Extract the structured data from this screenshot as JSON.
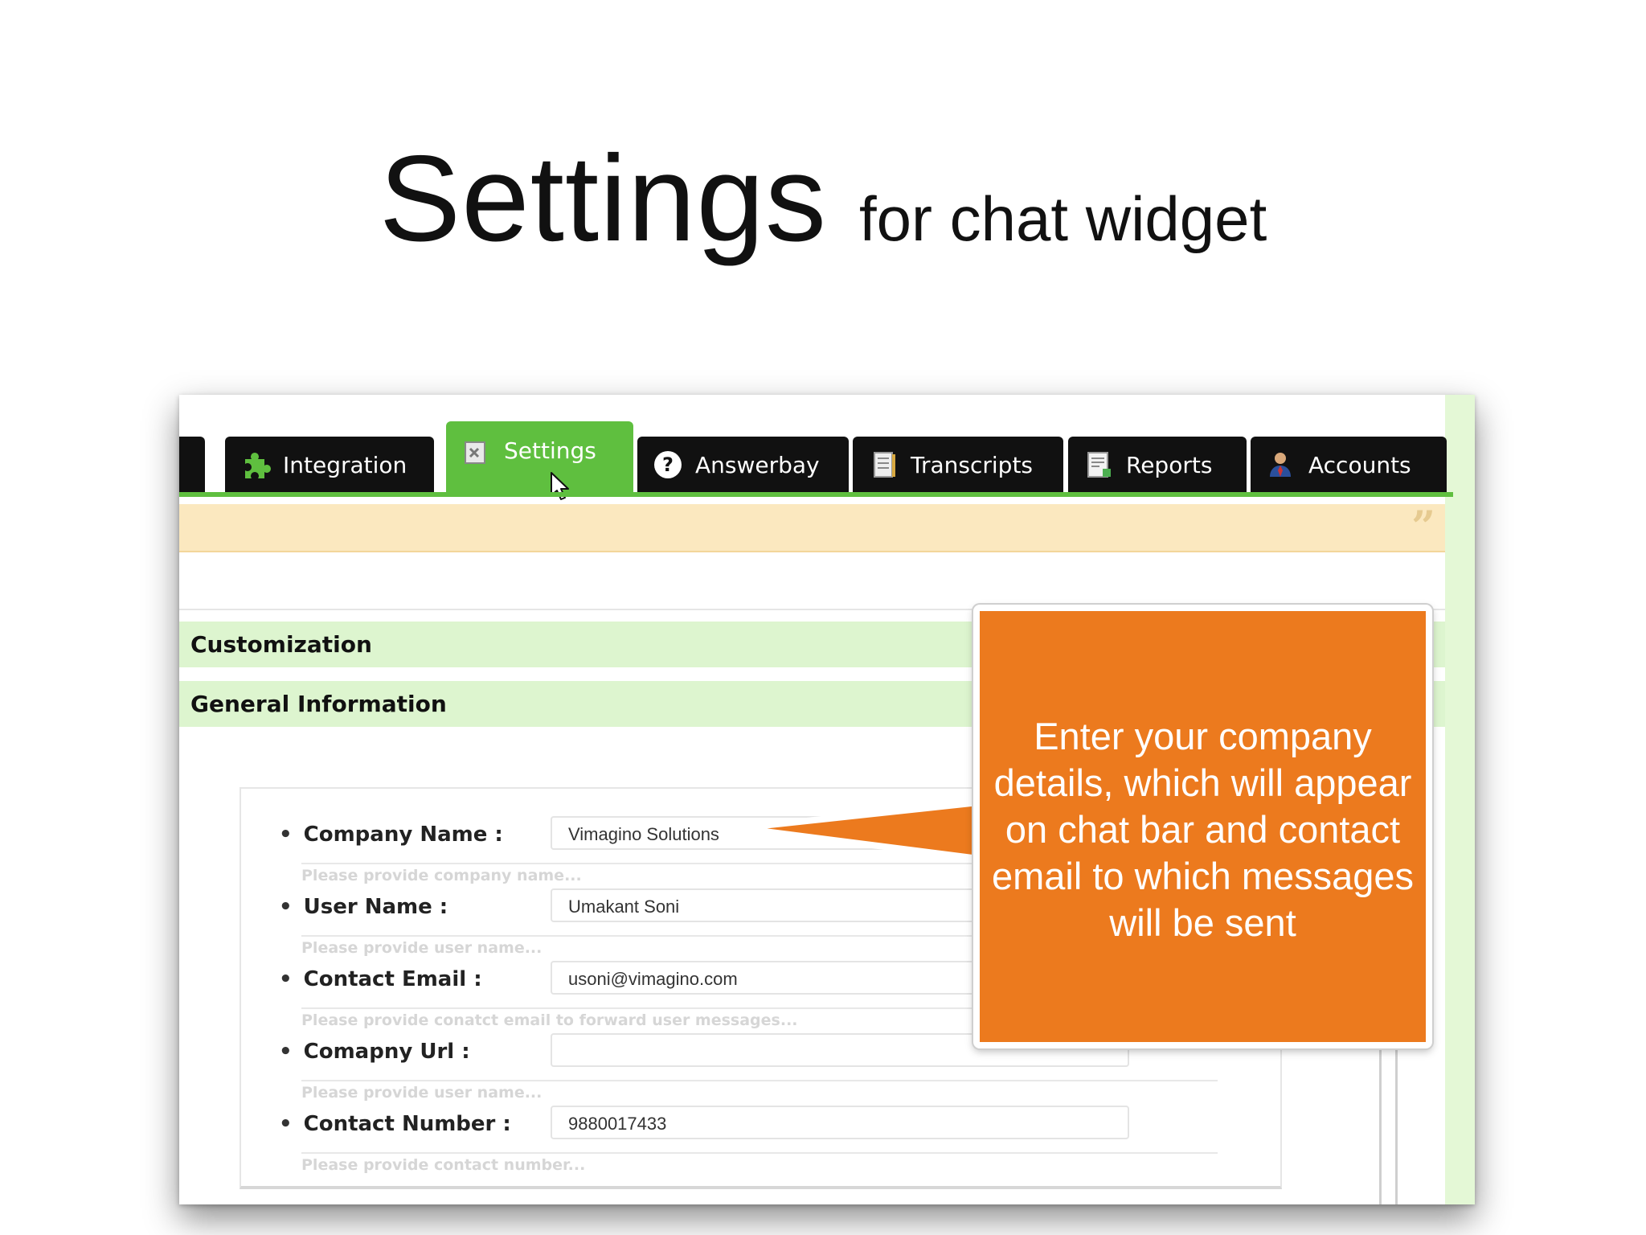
{
  "slide": {
    "title": "Settings",
    "subtitle": "for chat widget"
  },
  "tabs": [
    {
      "label": "Integration",
      "icon": "puzzle-icon",
      "active": false
    },
    {
      "label": "Settings",
      "icon": "settings-icon",
      "active": true
    },
    {
      "label": "Answerbay",
      "icon": "question-icon",
      "active": false
    },
    {
      "label": "Transcripts",
      "icon": "transcript-icon",
      "active": false
    },
    {
      "label": "Reports",
      "icon": "report-icon",
      "active": false
    },
    {
      "label": "Accounts",
      "icon": "account-icon",
      "active": false
    }
  ],
  "sections": {
    "customization": "Customization",
    "general": "General Information"
  },
  "form": {
    "company_name": {
      "label": "Company Name :",
      "value": "Vimagino Solutions",
      "hint": "Please provide company name..."
    },
    "user_name": {
      "label": "User Name :",
      "value": "Umakant Soni",
      "hint": "Please provide user name..."
    },
    "contact_email": {
      "label": "Contact Email :",
      "value": "usoni@vimagino.com",
      "hint": "Please provide conatct email to forward user messages..."
    },
    "company_url": {
      "label": "Comapny Url :",
      "value": "",
      "hint": "Please provide user name..."
    },
    "contact_number": {
      "label": "Contact Number :",
      "value": "9880017433",
      "hint": "Please provide contact number..."
    }
  },
  "callout": {
    "text": "Enter your company details, which will appear on chat bar and contact email to which messages will be sent"
  },
  "colors": {
    "accent_green": "#5fbf3f",
    "tab_black": "#111111",
    "section_green": "#ddf5cf",
    "notice_yellow": "#fbe8bf",
    "callout_orange": "#ec7a1e"
  }
}
